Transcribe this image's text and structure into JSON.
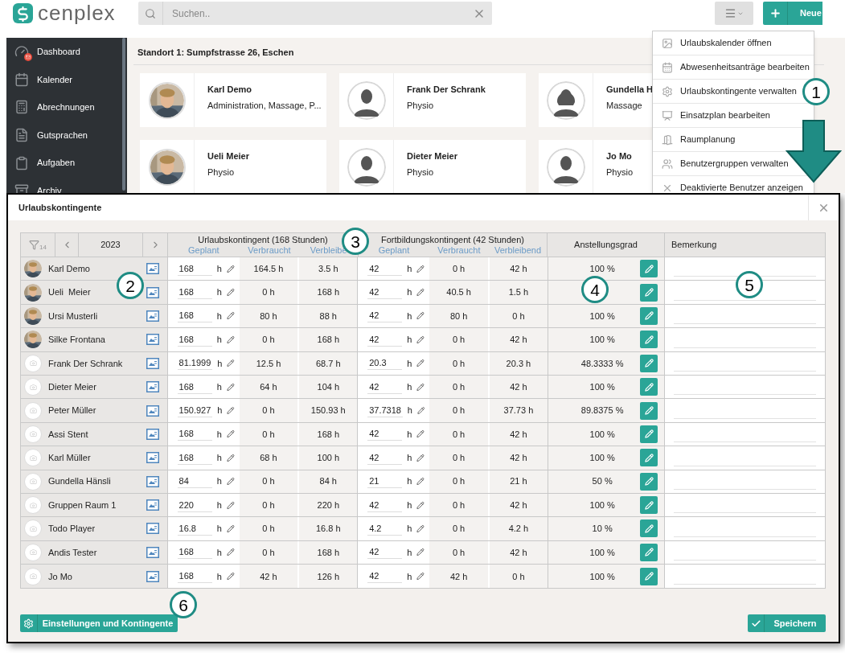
{
  "app": {
    "logo": "cenplex",
    "search": {
      "placeholder": "Suchen.."
    },
    "new_button": "Neue"
  },
  "sidebar": {
    "items": [
      {
        "label": "Dashboard",
        "notification": true
      },
      {
        "label": "Kalender",
        "notification": false
      },
      {
        "label": "Abrechnungen",
        "notification": false
      },
      {
        "label": "Gutsprachen",
        "notification": false
      },
      {
        "label": "Aufgaben",
        "notification": false
      },
      {
        "label": "Archiv",
        "notification": false
      }
    ]
  },
  "location": {
    "title": "Standort 1: Sumpfstrasse 26, Eschen",
    "staff": [
      {
        "name": "Karl Demo",
        "role": "Administration, Massage, P..."
      },
      {
        "name": "Frank Der Schrank",
        "role": "Physio",
        "kind": "silhouette"
      },
      {
        "name": "Gundella H",
        "role": "Massage",
        "kind": "silhouette_female"
      },
      {
        "name": "Ueli  Meier",
        "role": "Physio"
      },
      {
        "name": "Dieter Meier",
        "role": "Physio",
        "kind": "silhouette"
      },
      {
        "name": "Jo Mo",
        "role": "Physio",
        "kind": "silhouette"
      }
    ]
  },
  "menu": {
    "items": [
      "Urlaubskalender öffnen",
      "Abwesenheitsanträge bearbeiten",
      "Urlaubskontingente verwalten",
      "Einsatzplan bearbeiten",
      "Raumplanung",
      "Benutzergruppen verwalten",
      "Deaktivierte Benutzer anzeigen"
    ]
  },
  "dialog": {
    "title": "Urlaubskontingente",
    "filter_count": "14",
    "year": "2023",
    "groups": [
      {
        "title": "Urlaubskontingent (168 Stunden)",
        "columns": [
          "Geplant",
          "Verbraucht",
          "Verbleibe"
        ]
      },
      {
        "title": "Fortbildungskontingent (42 Stunden)",
        "columns": [
          "Geplant",
          "Verbraucht",
          "Verbleibend"
        ]
      }
    ],
    "grade_header": "Anstellungsgrad",
    "remark_header": "Bemerkung",
    "rows": [
      {
        "name": "Karl Demo",
        "vacation": [
          "168",
          "h",
          "164.5 h",
          "3.5 h"
        ],
        "training": [
          "42",
          "h",
          "0 h",
          "42 h"
        ],
        "grade": "100 %"
      },
      {
        "name": "Ueli  Meier",
        "vacation": [
          "168",
          "h",
          "0 h",
          "168 h"
        ],
        "training": [
          "42",
          "h",
          "40.5 h",
          "1.5 h"
        ]
      },
      {
        "name": "Ursi Musterli",
        "vacation": [
          "168",
          "h",
          "80 h",
          "88 h"
        ],
        "training": [
          "42",
          "h",
          "80 h",
          "0 h"
        ],
        "grade": "100 %"
      },
      {
        "name": "Silke Frontana",
        "vacation": [
          "168",
          "h",
          "0 h",
          "168 h"
        ],
        "training": [
          "42",
          "h",
          "0 h",
          "42 h"
        ],
        "grade": "100 %"
      },
      {
        "name": "Frank Der Schrank",
        "kind": "placeholder",
        "vacation": [
          "81.1999",
          "h",
          "12.5 h",
          "68.7 h"
        ],
        "training": [
          "20.3",
          "h",
          "0 h",
          "20.3 h"
        ],
        "grade": "48.3333 %"
      },
      {
        "name": "Dieter Meier",
        "kind": "placeholder",
        "vacation": [
          "168",
          "h",
          "64 h",
          "104 h"
        ],
        "training": [
          "42",
          "h",
          "0 h",
          "42 h"
        ],
        "grade": "100 %"
      },
      {
        "name": "Peter Müller",
        "kind": "placeholder",
        "vacation": [
          "150.927",
          "h",
          "0 h",
          "150.93 h"
        ],
        "training": [
          "37.7318",
          "h",
          "0 h",
          "37.73 h"
        ],
        "grade": "89.8375 %"
      },
      {
        "name": "Assi Stent",
        "kind": "placeholder",
        "vacation": [
          "168",
          "h",
          "0 h",
          "168 h"
        ],
        "training": [
          "42",
          "h",
          "0 h",
          "42 h"
        ],
        "grade": "100 %"
      },
      {
        "name": "Karl Müller",
        "kind": "placeholder",
        "vacation": [
          "168",
          "h",
          "68 h",
          "100 h"
        ],
        "training": [
          "42",
          "h",
          "0 h",
          "42 h"
        ],
        "grade": "100 %"
      },
      {
        "name": "Gundella Hänsli",
        "kind": "placeholder",
        "vacation": [
          "84",
          "h",
          "0 h",
          "84 h"
        ],
        "training": [
          "21",
          "h",
          "0 h",
          "21 h"
        ],
        "grade": "50 %"
      },
      {
        "name": "Gruppen Raum 1",
        "kind": "placeholder",
        "vacation": [
          "220",
          "h",
          "0 h",
          "220 h"
        ],
        "training": [
          "42",
          "h",
          "0 h",
          "42 h"
        ],
        "grade": "100 %"
      },
      {
        "name": "Todo Player",
        "kind": "placeholder",
        "vacation": [
          "16.8",
          "h",
          "0 h",
          "16.8 h"
        ],
        "training": [
          "4.2",
          "h",
          "0 h",
          "4.2 h"
        ],
        "grade": "10 %"
      },
      {
        "name": "Andis Tester",
        "kind": "placeholder",
        "vacation": [
          "168",
          "h",
          "0 h",
          "168 h"
        ],
        "training": [
          "42",
          "h",
          "0 h",
          "42 h"
        ],
        "grade": "100 %"
      },
      {
        "name": "Jo Mo",
        "kind": "placeholder",
        "vacation": [
          "168",
          "h",
          "42 h",
          "126 h"
        ],
        "training": [
          "42",
          "h",
          "42 h",
          "0 h"
        ],
        "grade": "100 %"
      }
    ],
    "buttons": {
      "settings": "Einstellungen und Kontingente",
      "save": "Speichern"
    }
  },
  "callouts": [
    "1",
    "2",
    "3",
    "4",
    "5",
    "6"
  ]
}
